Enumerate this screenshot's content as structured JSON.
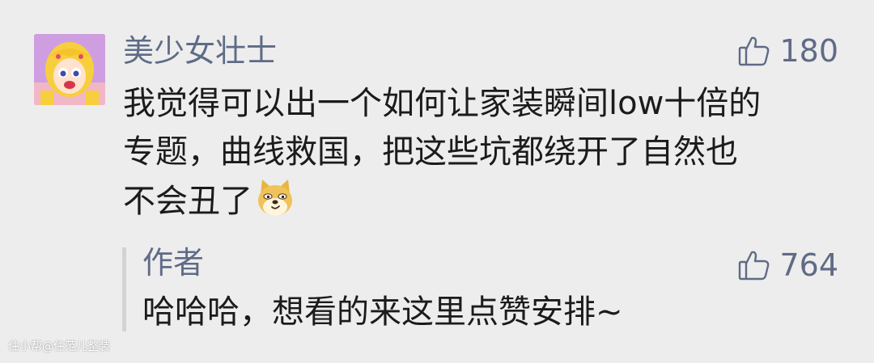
{
  "comment": {
    "username": "美少女壮士",
    "likes": "180",
    "lines": [
      "我觉得可以出一个如何让家装瞬间low十倍的",
      "专题，曲线救国，把这些坑都绕开了自然也",
      "不会丑了"
    ],
    "emoji": "doge-emoji"
  },
  "reply": {
    "author_label": "作者",
    "likes": "764",
    "text": "哈哈哈，想看的来这里点赞安排~"
  },
  "watermark": "住小帮@住范儿整装",
  "colors": {
    "background": "#ededed",
    "name": "#5f6b86",
    "text": "#1b1b1b",
    "reply_bar": "#d3d3d3"
  }
}
